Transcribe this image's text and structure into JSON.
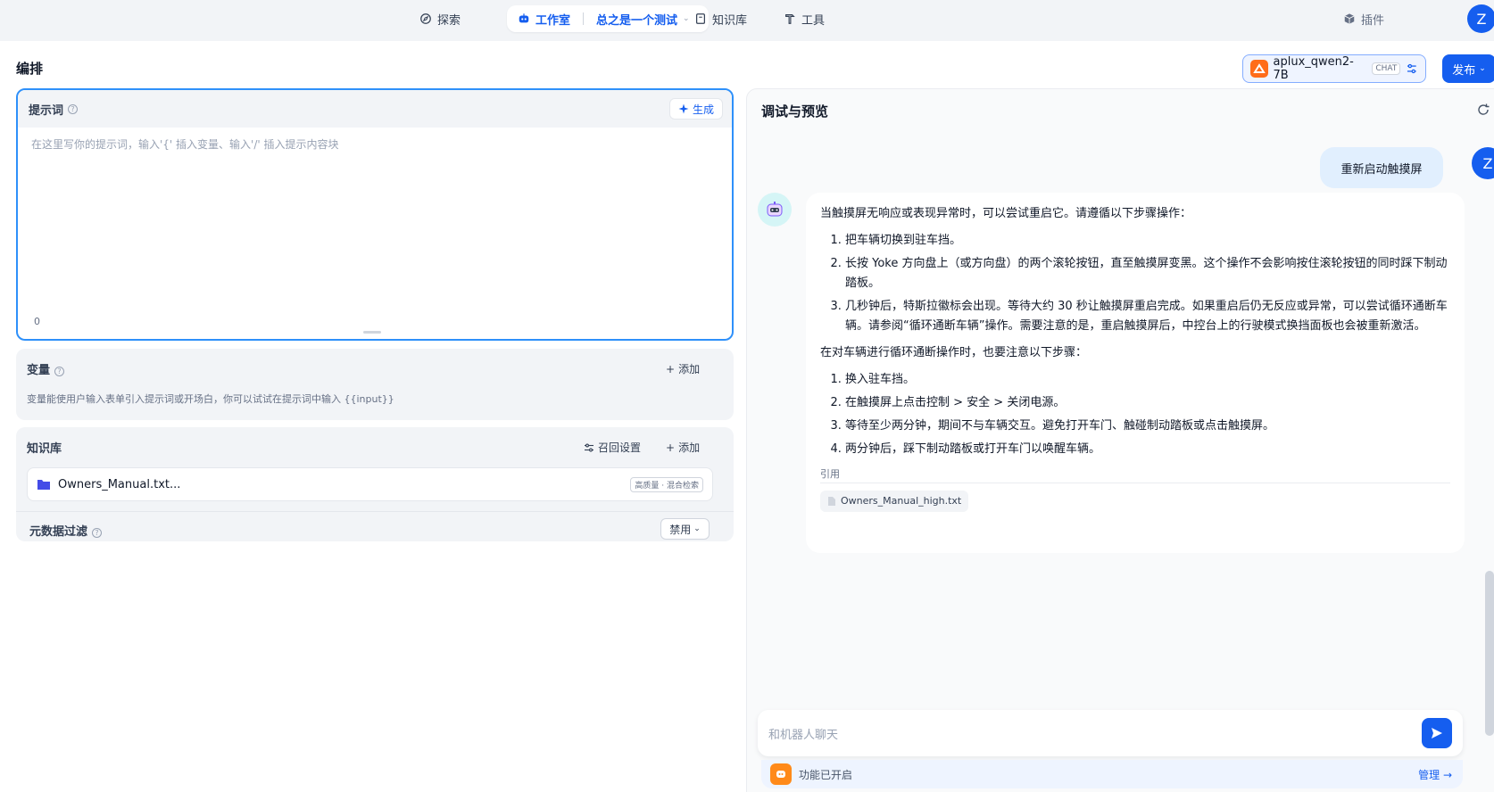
{
  "nav": {
    "explore": "探索",
    "studio": "工作室",
    "app_name": "总之是一个测试",
    "knowledge": "知识库",
    "tools": "工具",
    "plugins": "插件",
    "avatar": "Z"
  },
  "header": {
    "title": "编排",
    "model_name": "aplux_qwen2-7B",
    "model_tag": "CHAT",
    "publish": "发布"
  },
  "prompt": {
    "title": "提示词",
    "generate": "生成",
    "placeholder": "在这里写你的提示词，输入'{' 插入变量、输入'/' 插入提示内容块",
    "count": "0"
  },
  "variables": {
    "title": "变量",
    "add": "添加",
    "description": "变量能使用户输入表单引入提示词或开场白，你可以试试在提示词中输入 {{input}}"
  },
  "knowledge": {
    "title": "知识库",
    "recall": "召回设置",
    "add": "添加",
    "file_name": "Owners_Manual.txt...",
    "badge": "高质量 · 混合检索",
    "metadata_title": "元数据过滤",
    "metadata_value": "禁用"
  },
  "preview": {
    "title": "调试与预览",
    "user_avatar": "Z",
    "user_message": "重新启动触摸屏",
    "bot_intro": "当触摸屏无响应或表现异常时，可以尝试重启它。请遵循以下步骤操作：",
    "steps1": [
      "把车辆切换到驻车挡。",
      "长按 Yoke 方向盘上（或方向盘）的两个滚轮按钮，直至触摸屏变黑。这个操作不会影响按住滚轮按钮的同时踩下制动踏板。",
      "几秒钟后，特斯拉徽标会出现。等待大约 30 秒让触摸屏重启完成。如果重启后仍无反应或异常，可以尝试循环通断车辆。请参阅“循环通断车辆”操作。需要注意的是，重启触摸屏后，中控台上的行驶模式换挡面板也会被重新激活。"
    ],
    "bot_mid": "在对车辆进行循环通断操作时，也要注意以下步骤：",
    "steps2": [
      "换入驻车挡。",
      "在触摸屏上点击控制 > 安全 > 关闭电源。",
      "等待至少两分钟，期间不与车辆交互。避免打开车门、触碰制动踏板或点击触摸屏。",
      "两分钟后，踩下制动踏板或打开车门以唤醒车辆。"
    ],
    "citation_label": "引用",
    "citation_file": "Owners_Manual_high.txt",
    "input_placeholder": "和机器人聊天",
    "feature_text": "功能已开启",
    "manage": "管理"
  }
}
